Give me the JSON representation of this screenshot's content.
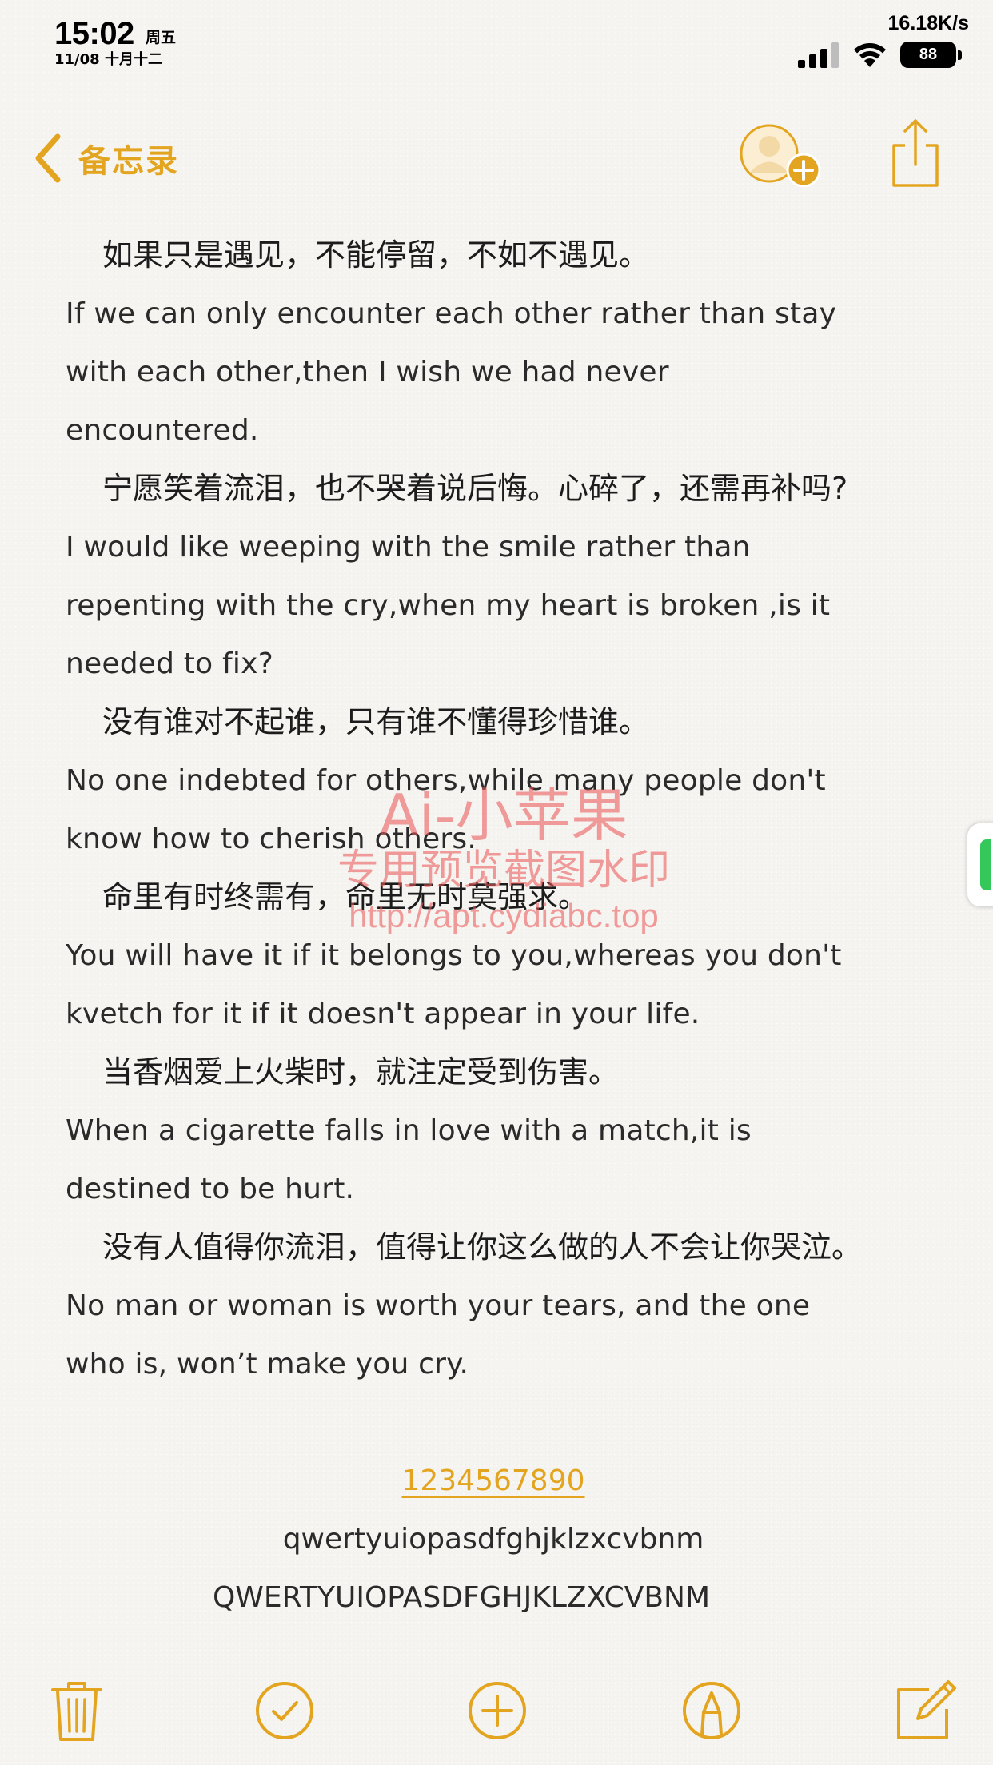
{
  "status_bar": {
    "time": "15:02",
    "weekday": "周五",
    "date": "11/08 十月十二",
    "net_speed": "16.18K/s",
    "battery": "88"
  },
  "nav": {
    "back_label": "备忘录"
  },
  "note": {
    "lines": [
      {
        "type": "zh",
        "text": "如果只是遇见，不能停留，不如不遇见。"
      },
      {
        "type": "en",
        "text": "If we can only encounter each other rather than stay"
      },
      {
        "type": "en",
        "text": "with each other,then I wish we had never"
      },
      {
        "type": "en",
        "text": "encountered."
      },
      {
        "type": "zh",
        "text": "宁愿笑着流泪，也不哭着说后悔。心碎了，还需再补吗?"
      },
      {
        "type": "en",
        "text": "I would like weeping with the smile rather than"
      },
      {
        "type": "en",
        "text": "repenting with the cry,when my heart is broken ,is it"
      },
      {
        "type": "en",
        "text": "needed to fix?"
      },
      {
        "type": "zh",
        "text": "没有谁对不起谁，只有谁不懂得珍惜谁。"
      },
      {
        "type": "en",
        "text": "No one indebted for others,while many people don't"
      },
      {
        "type": "en",
        "text": "know how to cherish others."
      },
      {
        "type": "zh",
        "text": "命里有时终需有，命里无时莫强求。"
      },
      {
        "type": "en",
        "text": "You will have it if it belongs to you,whereas you don't"
      },
      {
        "type": "en",
        "text": "kvetch for it if it doesn't appear in your life."
      },
      {
        "type": "zh",
        "text": "当香烟爱上火柴时，就注定受到伤害。"
      },
      {
        "type": "en",
        "text": "When a cigarette falls in love with a match,it is"
      },
      {
        "type": "en",
        "text": "destined to be hurt."
      },
      {
        "type": "zh",
        "text": "没有人值得你流泪，值得让你这么做的人不会让你哭泣。"
      },
      {
        "type": "en",
        "text": "No man or woman is worth your tears, and the one"
      },
      {
        "type": "en",
        "text": "who is, won’t make you cry."
      }
    ],
    "numbers": "1234567890",
    "lowercase": "qwertyuiopasdfghjklzxcvbnm",
    "uppercase": "QWERTYUIOPASDFGHJKLZXCVBNM"
  },
  "watermark": {
    "title": "Ai-小苹果",
    "subtitle": "专用预览截图水印",
    "url": "http://apt.cydiabc.top"
  },
  "toolbar": {
    "icons": [
      "trash-icon",
      "checklist-icon",
      "add-icon",
      "markup-icon",
      "compose-icon"
    ]
  },
  "colors": {
    "accent": "#e3a520",
    "watermark": "#eb5a5a",
    "background": "#f5f4f1"
  }
}
